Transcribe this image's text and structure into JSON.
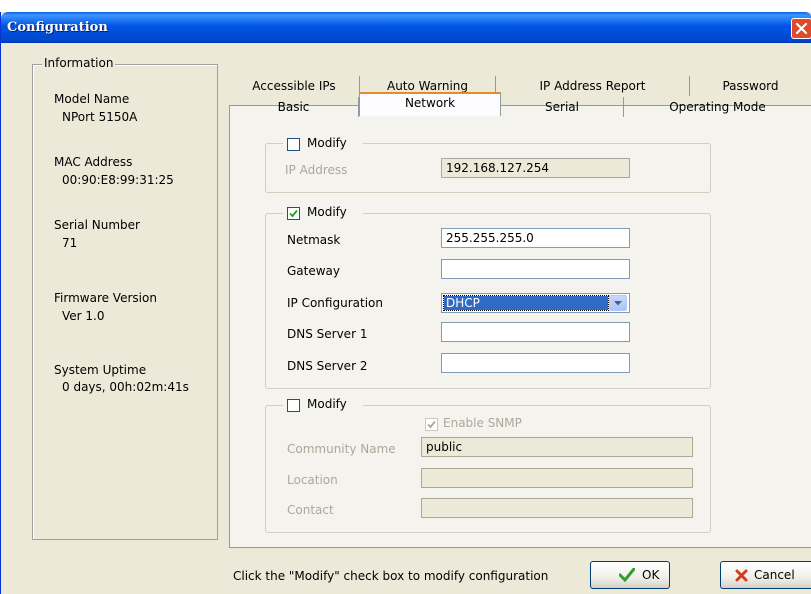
{
  "window": {
    "title": "Configuration"
  },
  "info": {
    "legend": "Information",
    "model_label": "Model Name",
    "model_value": "NPort 5150A",
    "mac_label": "MAC Address",
    "mac_value": "00:90:E8:99:31:25",
    "serial_label": "Serial Number",
    "serial_value": "71",
    "firmware_label": "Firmware Version",
    "firmware_value": "Ver 1.0",
    "uptime_label": "System Uptime",
    "uptime_value": "0 days, 00h:02m:41s"
  },
  "tabs": {
    "row1": [
      "Accessible IPs",
      "Auto Warning",
      "IP Address Report",
      "Password"
    ],
    "row2": [
      "Basic",
      "Network",
      "Serial",
      "Operating Mode"
    ],
    "active": "Network"
  },
  "group1": {
    "modify_label": "Modify",
    "modify_checked": false,
    "ip_label": "IP Address",
    "ip_value": "192.168.127.254"
  },
  "group2": {
    "modify_label": "Modify",
    "modify_checked": true,
    "netmask_label": "Netmask",
    "netmask_value": "255.255.255.0",
    "gateway_label": "Gateway",
    "gateway_value": "",
    "ipconfig_label": "IP Configuration",
    "ipconfig_value": "DHCP",
    "dns1_label": "DNS Server 1",
    "dns1_value": "",
    "dns2_label": "DNS Server 2",
    "dns2_value": ""
  },
  "group3": {
    "modify_label": "Modify",
    "modify_checked": false,
    "snmp_label": "Enable SNMP",
    "snmp_checked": true,
    "community_label": "Community Name",
    "community_value": "public",
    "location_label": "Location",
    "location_value": "",
    "contact_label": "Contact",
    "contact_value": ""
  },
  "footer": {
    "hint": "Click the \"Modify\" check box to modify configuration",
    "ok_label": "OK",
    "cancel_label": "Cancel"
  },
  "icons": {
    "close": "close-icon",
    "ok": "checkmark-icon",
    "cancel": "x-icon",
    "dropdown": "chevron-down-icon"
  },
  "colors": {
    "titlebar": "#0054e3",
    "selection": "#316ac5",
    "ok_check": "#2e9e2e",
    "cancel_x": "#d23c1e"
  }
}
